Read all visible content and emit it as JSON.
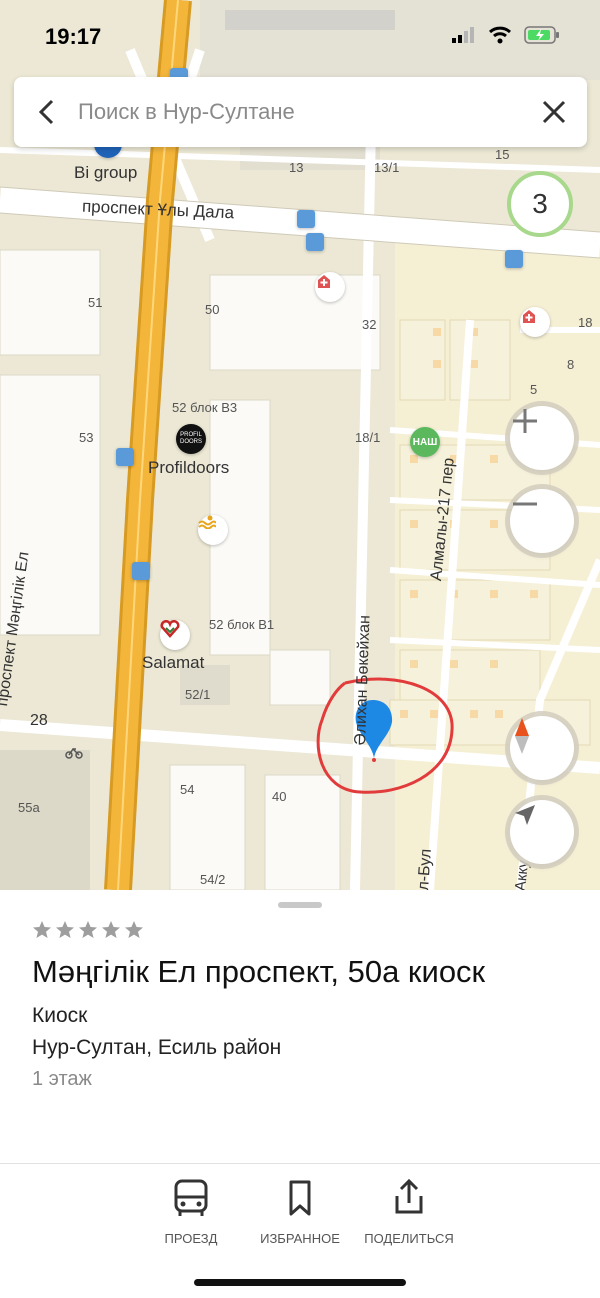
{
  "status_bar": {
    "time": "19:17"
  },
  "search": {
    "placeholder": "Поиск в Нур-Султане"
  },
  "map": {
    "street_labels": {
      "uly_dala": "проспект Ұлы Дала",
      "mangilik_el": "проспект Мәңгілік Ел",
      "bokeikhan": "Әлихан Бөкейхан",
      "almaly": "Алмалы-217 пер",
      "bul": "л-Бул",
      "akku": "Акку"
    },
    "house_numbers": {
      "h13": "13",
      "h13_1": "13/1",
      "h15": "15",
      "h51": "51",
      "h50": "50",
      "h32": "32",
      "h18": "18",
      "h8": "8",
      "h5": "5",
      "h52b3": "52 блок В3",
      "h18_1": "18/1",
      "h53": "53",
      "h52b1": "52 блок В1",
      "h52_1": "52/1",
      "h28": "28",
      "h54": "54",
      "h40": "40",
      "h55a": "55а",
      "h54_2": "54/2"
    },
    "poi": {
      "bigroup": "Bi group",
      "profildoors": "Profildoors",
      "salamat": "Salamat"
    },
    "cluster_count": "3",
    "colors": {
      "road_main": "#f3b53a",
      "marker": "#1e88e5",
      "highlight": "#e23b3b"
    }
  },
  "place": {
    "rating_stars": 5,
    "title": "Мәңгілік Ел проспект, 50а киоск",
    "category": "Киоск",
    "address": "Нур-Султан, Есиль район",
    "floor": "1 этаж"
  },
  "actions": {
    "route": "ПРОЕЗД",
    "favorite": "ИЗБРАННОЕ",
    "share": "ПОДЕЛИТЬСЯ"
  }
}
